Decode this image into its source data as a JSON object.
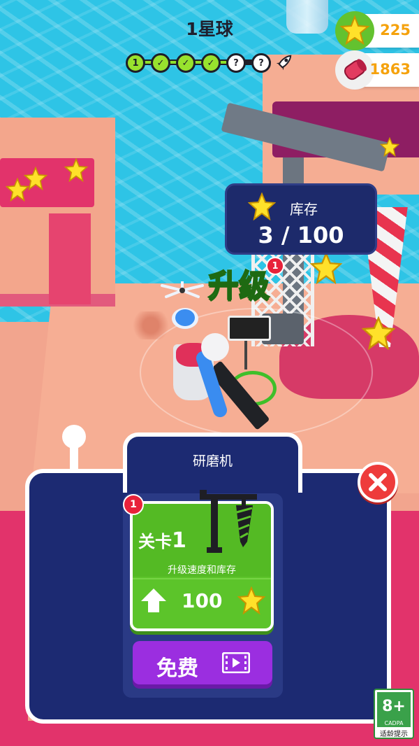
{
  "hud": {
    "level_title": "1星球",
    "progress": {
      "nodes": [
        {
          "label": "1",
          "state": "done"
        },
        {
          "label": "✓",
          "state": "done"
        },
        {
          "label": "✓",
          "state": "done"
        },
        {
          "label": "✓",
          "state": "done"
        },
        {
          "label": "?",
          "state": "locked"
        },
        {
          "label": "?",
          "state": "locked"
        }
      ],
      "end_icon": "rocket-icon"
    },
    "currency": {
      "stars": "225",
      "gems": "1863",
      "star_icon": "star-icon",
      "gem_icon": "gem-roll-icon",
      "value_color": "#f5a20c"
    }
  },
  "world": {
    "storage": {
      "label": "库存",
      "amount": "3 / 100",
      "icon": "star-icon"
    },
    "upgrade_float": {
      "text": "升级",
      "badge": "1"
    }
  },
  "panel": {
    "title": "研磨机",
    "upgrade_card": {
      "badge": "1",
      "level_prefix": "关卡",
      "level_number": "1",
      "description": "升级速度和库存",
      "cost": "100",
      "machine_icon": "drill-machine-icon",
      "arrow_icon": "up-arrow-icon",
      "cost_icon": "star-icon",
      "color": "#5cc42a"
    },
    "free_button": {
      "label": "免费",
      "icon": "video-icon",
      "color": "#9b2ee0"
    },
    "close_icon": "close-icon"
  },
  "age_rating": {
    "rating": "8+",
    "org": "CADPA",
    "caption": "适龄提示"
  }
}
